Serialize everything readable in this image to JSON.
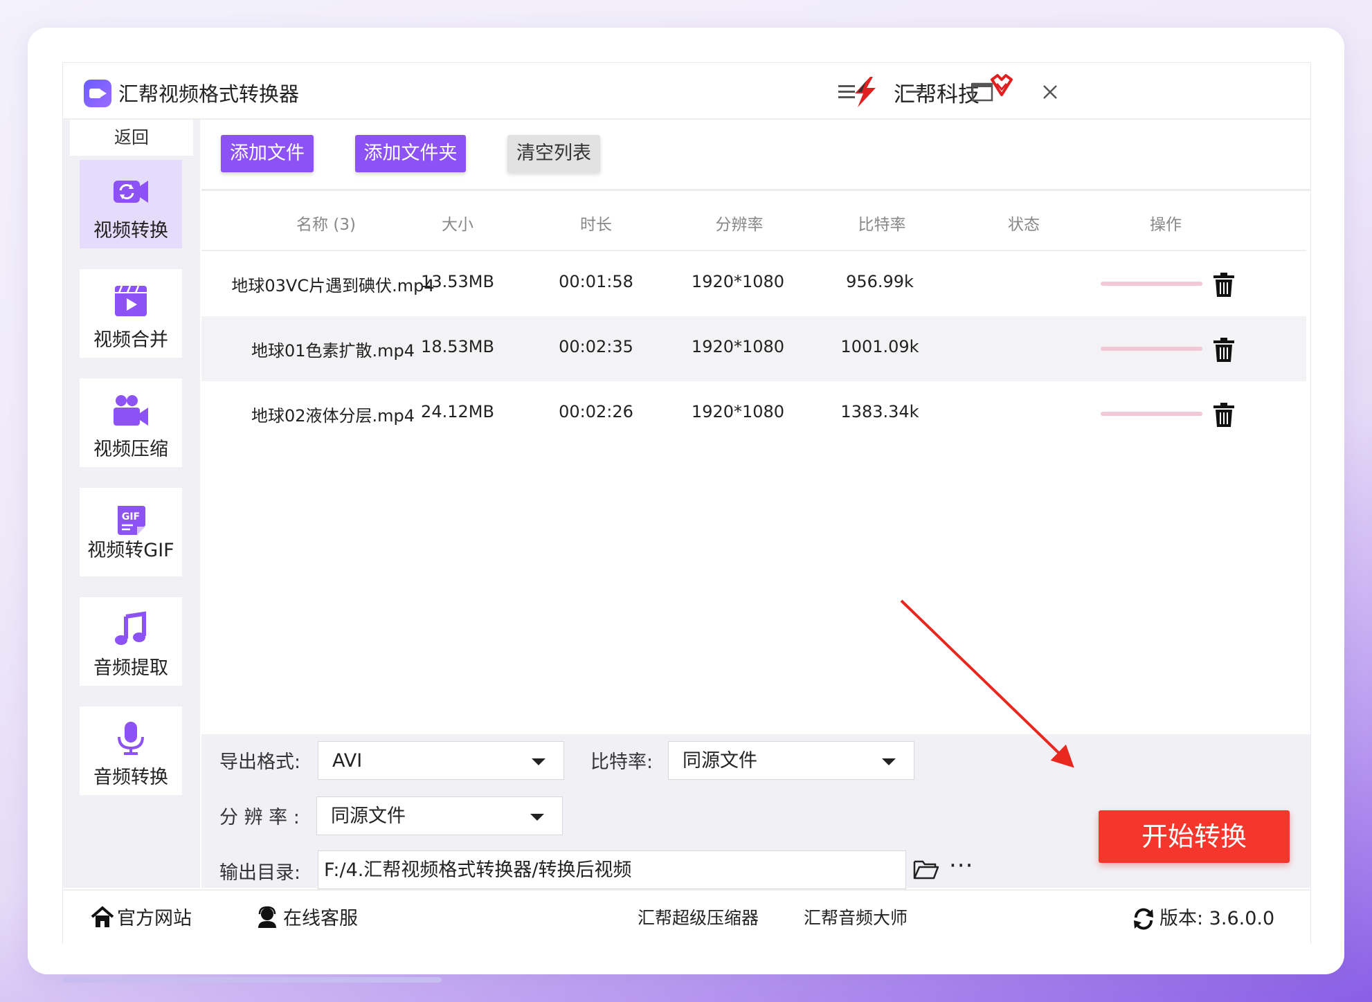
{
  "titlebar": {
    "app_title": "汇帮视频格式转换器",
    "brand_name": "汇帮科技"
  },
  "sidebar": {
    "back_label": "返回",
    "items": [
      {
        "label": "视频转换",
        "icon": "video-convert-icon",
        "active": true
      },
      {
        "label": "视频合并",
        "icon": "video-merge-icon",
        "active": false
      },
      {
        "label": "视频压缩",
        "icon": "video-compress-icon",
        "active": false
      },
      {
        "label": "视频转GIF",
        "icon": "gif-icon",
        "active": false
      },
      {
        "label": "音频提取",
        "icon": "music-note-icon",
        "active": false
      },
      {
        "label": "音频转换",
        "icon": "microphone-icon",
        "active": false
      }
    ],
    "gif_badge": "GIF"
  },
  "toolbar": {
    "add_file": "添加文件",
    "add_folder": "添加文件夹",
    "clear_list": "清空列表"
  },
  "table": {
    "headers": [
      "名称 (3)",
      "大小",
      "时长",
      "分辨率",
      "比特率",
      "状态",
      "操作"
    ],
    "rows": [
      {
        "name": "地球03VC片遇到碘伏.mp4",
        "size": "13.53MB",
        "duration": "00:01:58",
        "resolution": "1920*1080",
        "bitrate": "956.99k"
      },
      {
        "name": "地球01色素扩散.mp4",
        "size": "18.53MB",
        "duration": "00:02:35",
        "resolution": "1920*1080",
        "bitrate": "1001.09k"
      },
      {
        "name": "地球02液体分层.mp4",
        "size": "24.12MB",
        "duration": "00:02:26",
        "resolution": "1920*1080",
        "bitrate": "1383.34k"
      }
    ]
  },
  "settings": {
    "format_label": "导出格式:",
    "format_value": "AVI",
    "bitrate_label": "比特率:",
    "bitrate_value": "同源文件",
    "resolution_label": "分 辨 率 :",
    "resolution_value": "同源文件",
    "output_label": "输出目录:",
    "output_path": "F:/4.汇帮视频格式转换器/转换后视频",
    "more": "···",
    "start_button": "开始转换"
  },
  "footer": {
    "website": "官方网站",
    "support": "在线客服",
    "link1": "汇帮超级压缩器",
    "link2": "汇帮音频大师",
    "version": "版本:  3.6.0.0"
  },
  "colors": {
    "accent_purple": "#8c52f3",
    "start_red": "#f4362c",
    "arrow_red": "#e8281e"
  }
}
